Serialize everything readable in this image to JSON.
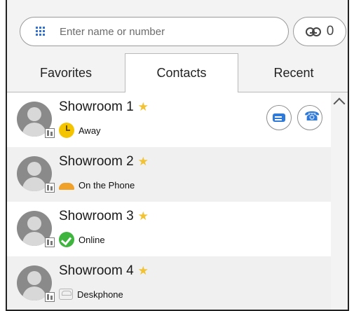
{
  "search": {
    "placeholder": "Enter name or number",
    "value": ""
  },
  "voicemail": {
    "count": "0",
    "icon": "voicemail-icon"
  },
  "tabs": [
    {
      "label": "Favorites",
      "active": false
    },
    {
      "label": "Contacts",
      "active": true
    },
    {
      "label": "Recent",
      "active": false
    }
  ],
  "contacts": [
    {
      "name": "Showroom 1",
      "favorite": true,
      "status": "Away",
      "status_icon": "clock-icon",
      "actions": [
        "message-icon",
        "call-icon"
      ]
    },
    {
      "name": "Showroom 2",
      "favorite": true,
      "status": "On the Phone",
      "status_icon": "phone-handset-icon"
    },
    {
      "name": "Showroom 3",
      "favorite": true,
      "status": "Online",
      "status_icon": "check-icon"
    },
    {
      "name": "Showroom 4",
      "favorite": true,
      "status": "Deskphone",
      "status_icon": "deskphone-icon"
    }
  ],
  "colors": {
    "accent": "#2f7ad8",
    "star": "#f1c232",
    "away": "#f5c400",
    "on_phone": "#f0a12a",
    "online": "#3fb53f"
  }
}
